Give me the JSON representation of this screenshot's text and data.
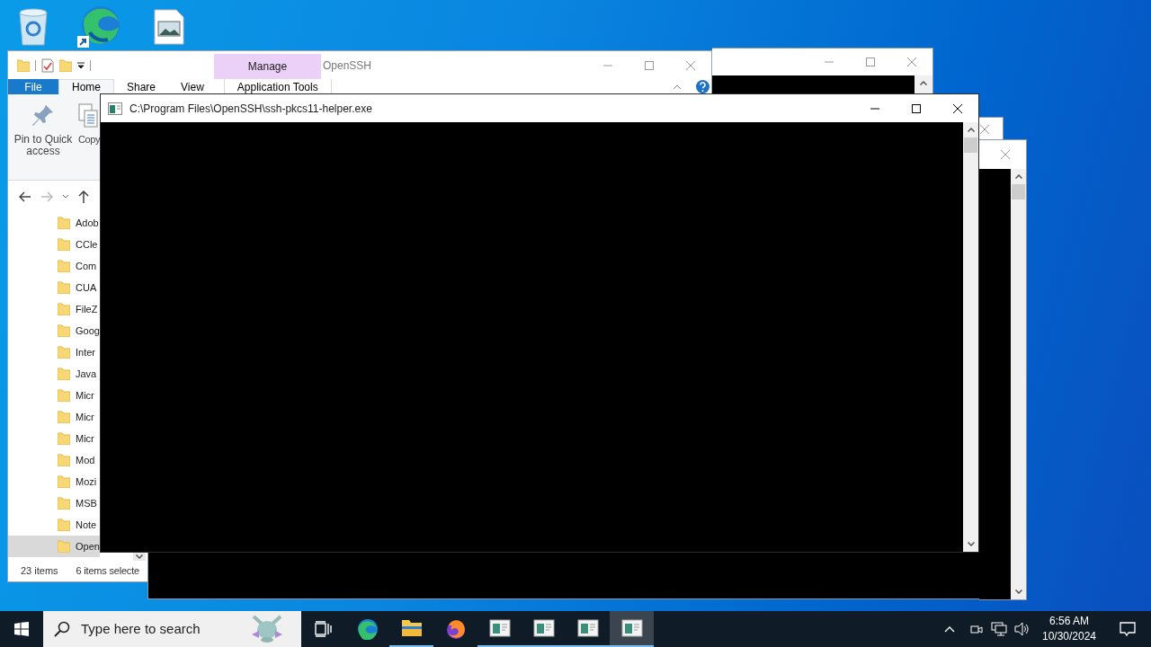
{
  "explorer": {
    "title": "OpenSSH",
    "context_group": "Manage",
    "tabs": [
      {
        "label": "File",
        "kind": "file",
        "selected": false
      },
      {
        "label": "Home",
        "kind": "plain",
        "selected": true
      },
      {
        "label": "Share",
        "kind": "plain",
        "selected": false
      },
      {
        "label": "View",
        "kind": "plain",
        "selected": false
      },
      {
        "label": "Application Tools",
        "kind": "context",
        "selected": false
      }
    ],
    "ribbon_buttons": [
      {
        "label": "Pin to Quick access",
        "kind": "pin"
      },
      {
        "label": "Copy",
        "kind": "copy"
      }
    ],
    "folders": [
      {
        "name": "Adob",
        "selected": false
      },
      {
        "name": "CCle",
        "selected": false
      },
      {
        "name": "Com",
        "selected": false
      },
      {
        "name": "CUA",
        "selected": false
      },
      {
        "name": "FileZ",
        "selected": false
      },
      {
        "name": "Goog",
        "selected": false
      },
      {
        "name": "Inter",
        "selected": false
      },
      {
        "name": "Java",
        "selected": false
      },
      {
        "name": "Micr",
        "selected": false
      },
      {
        "name": "Micr",
        "selected": false
      },
      {
        "name": "Micr",
        "selected": false
      },
      {
        "name": "Mod",
        "selected": false
      },
      {
        "name": "Mozi",
        "selected": false
      },
      {
        "name": "MSB",
        "selected": false
      },
      {
        "name": "Note",
        "selected": false
      },
      {
        "name": "Open",
        "selected": true
      }
    ],
    "status": {
      "item_count": "23 items",
      "selection": "6 items selecte"
    }
  },
  "console": {
    "title": "C:\\Program Files\\OpenSSH\\ssh-pkcs11-helper.exe"
  },
  "taskbar": {
    "search": {
      "placeholder": "Type here to search"
    },
    "apps": [
      {
        "kind": "edge",
        "running": false,
        "selected": false
      },
      {
        "kind": "explorer",
        "running": true,
        "selected": false
      },
      {
        "kind": "firefox",
        "running": false,
        "selected": false
      },
      {
        "kind": "console",
        "running": true,
        "selected": false
      },
      {
        "kind": "console",
        "running": true,
        "selected": false
      },
      {
        "kind": "console",
        "running": true,
        "selected": false
      },
      {
        "kind": "console",
        "running": true,
        "selected": true
      }
    ],
    "clock": {
      "time": "6:56 AM",
      "date": "10/30/2024"
    }
  }
}
